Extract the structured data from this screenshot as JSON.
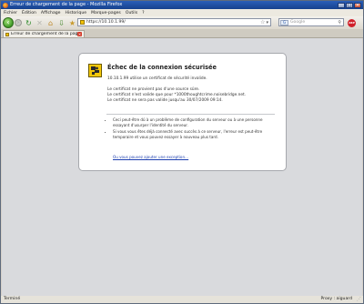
{
  "window": {
    "title": "Erreur de chargement de la page - Mozilla Firefox"
  },
  "menubar": {
    "items": [
      "Fichier",
      "Édition",
      "Affichage",
      "Historique",
      "Marque-pages",
      "Outils",
      "?"
    ]
  },
  "navbar": {
    "url": "https://10.10.1.99/",
    "search_placeholder": "Google",
    "search_engine": "G"
  },
  "tabs": [
    {
      "label": "Erreur de chargement de la page"
    }
  ],
  "error": {
    "title": "Échec de la connexion sécurisée",
    "intro": "10.10.1.99 utilise un certificat de sécurité invalide.",
    "details": [
      "Le certificat ne provient pas d'une source sûre.",
      "Le certificat n'est valide que pour *1000thoughtcrime.noisebridge.net.",
      "Le certificat ne sera pas valide jusqu'au 30/07/2009 09:14."
    ],
    "bullets": [
      "Ceci peut-être dû à un problème de configuration du serveur ou à une personne essayant d'usurper l'identité du serveur.",
      "Si vous vous êtes déjà connecté avec succès à ce serveur, l'erreur est peut-être temporaire et vous pouvez essayer à nouveau plus tard."
    ],
    "exception_link": "Ou vous pouvez ajouter une exception…"
  },
  "status": {
    "left": "Terminé",
    "right": "Proxy : aiguard"
  },
  "colors": {
    "titlebar": "#16418e",
    "warning": "#f4c80b",
    "link": "#1d3fb0"
  }
}
